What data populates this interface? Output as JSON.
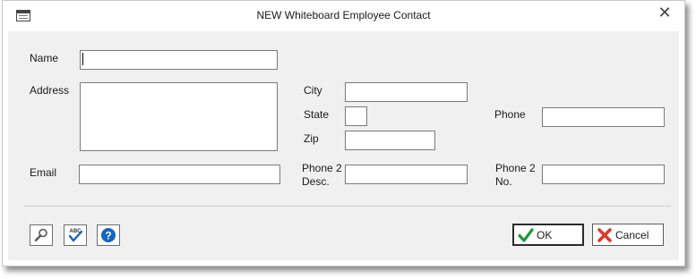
{
  "window": {
    "title": "NEW Whiteboard Employee Contact",
    "close_glyph": "✕"
  },
  "form": {
    "name": {
      "label": "Name",
      "value": ""
    },
    "address": {
      "label": "Address",
      "value": ""
    },
    "city": {
      "label": "City",
      "value": ""
    },
    "state": {
      "label": "State",
      "value": ""
    },
    "zip": {
      "label": "Zip",
      "value": ""
    },
    "phone": {
      "label": "Phone",
      "value": ""
    },
    "email": {
      "label": "Email",
      "value": ""
    },
    "phone2_desc": {
      "label": "Phone 2\nDesc.",
      "value": ""
    },
    "phone2_no": {
      "label": "Phone 2\nNo.",
      "value": ""
    }
  },
  "toolbar": {
    "icons": [
      "search-icon",
      "spellcheck-icon",
      "help-icon"
    ]
  },
  "buttons": {
    "ok_label": "OK",
    "cancel_label": "Cancel"
  },
  "colors": {
    "ok_check": "#1e9a3a",
    "cancel_x": "#e0372c",
    "help_blue": "#1565c0"
  }
}
